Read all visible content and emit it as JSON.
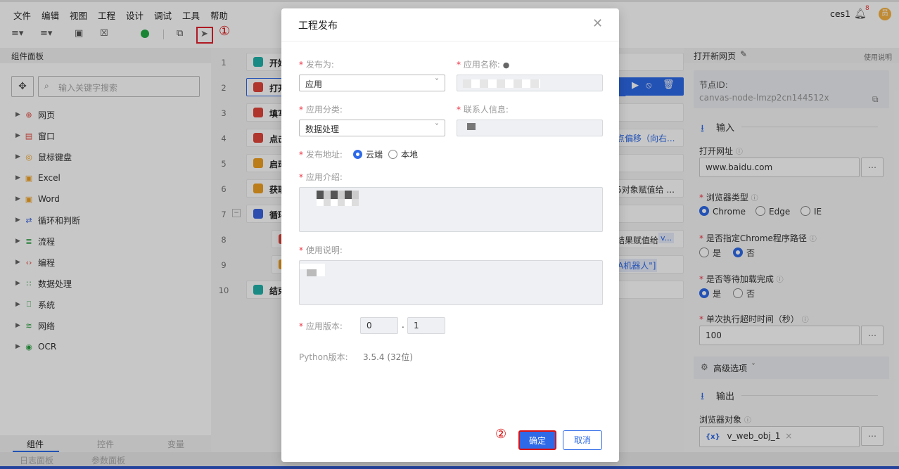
{
  "menu": [
    "文件",
    "编辑",
    "视图",
    "工程",
    "设计",
    "调试",
    "工具",
    "帮助"
  ],
  "user": {
    "name": "ces1",
    "notif_count": "8",
    "avatar_text": "员"
  },
  "annotations": {
    "one": "①",
    "two": "②"
  },
  "left_panel": {
    "title": "组件面板",
    "search_placeholder": "输入关键字搜索",
    "tree": [
      {
        "label": "网页",
        "icon": "globe-icon",
        "color": "#e0453a"
      },
      {
        "label": "窗口",
        "icon": "window-icon",
        "color": "#e0453a"
      },
      {
        "label": "鼠标键盘",
        "icon": "mouse-icon",
        "color": "#f0a020"
      },
      {
        "label": "Excel",
        "icon": "excel-icon",
        "color": "#f0a020"
      },
      {
        "label": "Word",
        "icon": "word-icon",
        "color": "#f0a020"
      },
      {
        "label": "循环和判断",
        "icon": "loop-icon",
        "color": "#3a64e0"
      },
      {
        "label": "流程",
        "icon": "flow-icon",
        "color": "#2aa040"
      },
      {
        "label": "编程",
        "icon": "code-icon",
        "color": "#e0453a"
      },
      {
        "label": "数据处理",
        "icon": "data-icon",
        "color": "#2aa040"
      },
      {
        "label": "系统",
        "icon": "system-icon",
        "color": "#2aa040"
      },
      {
        "label": "网络",
        "icon": "network-icon",
        "color": "#2aa040"
      },
      {
        "label": "OCR",
        "icon": "ocr-icon",
        "color": "#2aa040"
      }
    ],
    "tabs": [
      "组件",
      "控件",
      "变量"
    ]
  },
  "bottom_tabs": [
    "日志面板",
    "参数面板"
  ],
  "flow": {
    "line_numbers": [
      "1",
      "2",
      "3",
      "4",
      "5",
      "6",
      "7",
      "8",
      "9",
      "10"
    ],
    "rows": [
      {
        "text": "开始"
      },
      {
        "text": "打开"
      },
      {
        "text": "填写"
      },
      {
        "text": "点击"
      },
      {
        "text": "启动"
      },
      {
        "text": "获取"
      },
      {
        "text": "循环"
      },
      {
        "text": ""
      },
      {
        "text": ""
      },
      {
        "text": "结束"
      }
    ],
    "right_snips": [
      "点偏移（向右...",
      "5对象赋值给 ...",
      "结果赋值给",
      "v...",
      "A机器人\"]"
    ]
  },
  "right_panel": {
    "title": "打开新网页",
    "help": "使用说明",
    "node_id_label": "节点ID:",
    "node_id": "canvas-node-lmzp2cn144512x",
    "input_section": "输入",
    "url_label": "打开网址",
    "url_value": "www.baidu.com",
    "browser_label": "浏览器类型",
    "browser_options": [
      "Chrome",
      "Edge",
      "IE"
    ],
    "chrome_path_label": "是否指定Chrome程序路径",
    "yes": "是",
    "no": "否",
    "wait_label": "是否等待加载完成",
    "timeout_label": "单次执行超时时间（秒）",
    "timeout_value": "100",
    "advanced": "高级选项",
    "output_section": "输出",
    "browser_obj_label": "浏览器对象",
    "browser_obj_value": "v_web_obj_1",
    "var_prefix": "{x}"
  },
  "modal": {
    "title": "工程发布",
    "publish_as_label": "发布为:",
    "publish_as_value": "应用",
    "app_name_label": "应用名称:",
    "category_label": "应用分类:",
    "category_value": "数据处理",
    "contact_label": "联系人信息:",
    "address_label": "发布地址:",
    "address_cloud": "云端",
    "address_local": "本地",
    "intro_label": "应用介绍:",
    "usage_label": "使用说明:",
    "version_label": "应用版本:",
    "version_major": "0",
    "version_minor": "1",
    "python_label": "Python版本:",
    "python_value": "3.5.4 (32位)",
    "confirm": "确定",
    "cancel": "取消"
  }
}
